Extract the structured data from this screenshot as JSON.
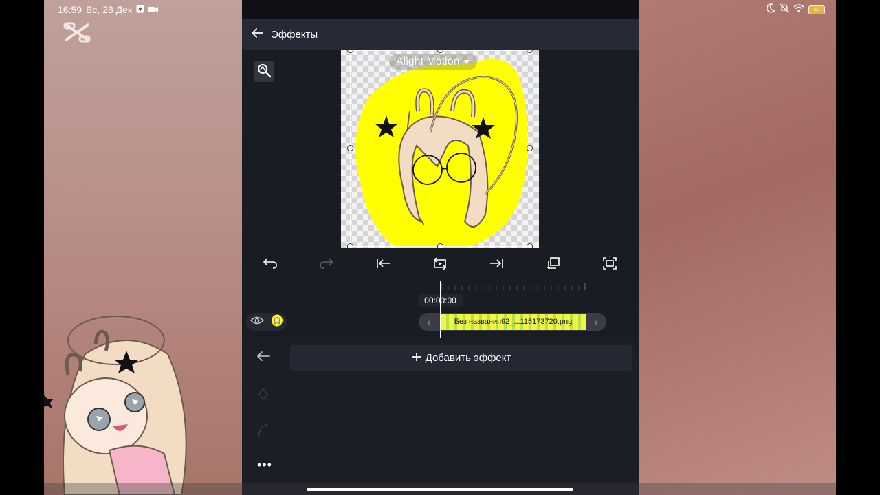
{
  "status": {
    "time": "16:59",
    "date": "Вс, 28 Дек",
    "battery": "80"
  },
  "header": {
    "title": "Эффекты"
  },
  "preview": {
    "watermark": "Alight Motion"
  },
  "timeline": {
    "timecode": "00:00:00",
    "clip_name": "Без названия92_...115173720.png"
  },
  "panel": {
    "add_effect_label": "Добавить эффект",
    "more_label": "•••"
  },
  "colors": {
    "app_bg": "#1a1c23",
    "topbar_bg": "#262a36",
    "clip_yellow": "#f1f542",
    "blob_yellow": "#ffff00"
  },
  "icons": {
    "back": "arrow-left-icon",
    "zoom": "magnifier-icon",
    "undo": "undo-icon",
    "redo": "redo-icon",
    "jump_start": "jump-to-start-icon",
    "loop": "loop-play-icon",
    "jump_end": "jump-to-end-icon",
    "copy": "duplicate-icon",
    "fullscreen": "fullscreen-icon",
    "visibility": "eye-icon"
  }
}
